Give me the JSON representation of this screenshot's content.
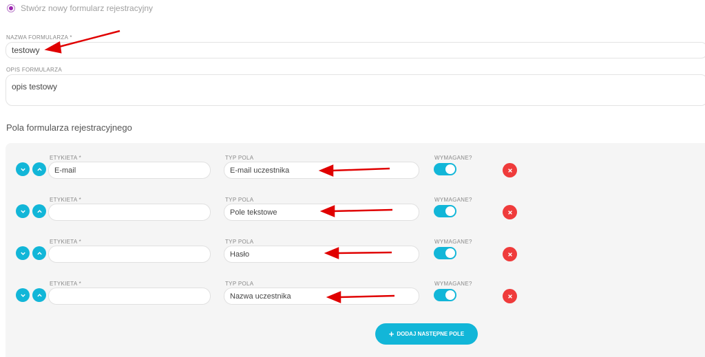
{
  "header": {
    "radio_label": "Stwórz nowy formularz rejestracyjny"
  },
  "form": {
    "name_label": "NAZWA FORMULARZA *",
    "name_value": "testowy",
    "desc_label": "OPIS FORMULARZA",
    "desc_value": "opis testowy"
  },
  "fields_section": {
    "title": "Pola formularza rejestracyjnego",
    "rows": [
      {
        "label_caption": "ETYKIETA *",
        "label_value": "E-mail",
        "type_caption": "TYP POLA",
        "type_value": "E-mail uczestnika",
        "required_caption": "WYMAGANE?",
        "required": true
      },
      {
        "label_caption": "ETYKIETA *",
        "label_value": "",
        "type_caption": "TYP POLA",
        "type_value": "Pole tekstowe",
        "required_caption": "WYMAGANE?",
        "required": true
      },
      {
        "label_caption": "ETYKIETA *",
        "label_value": "",
        "type_caption": "TYP POLA",
        "type_value": "Hasło",
        "required_caption": "WYMAGANE?",
        "required": true
      },
      {
        "label_caption": "ETYKIETA *",
        "label_value": "",
        "type_caption": "TYP POLA",
        "type_value": "Nazwa uczestnika",
        "required_caption": "WYMAGANE?",
        "required": true
      }
    ],
    "add_button_label": "DODAJ NASTĘPNE POLE"
  },
  "colors": {
    "accent": "#12b6d8",
    "danger": "#ef3b3b",
    "radio": "#9c27b0",
    "annotation_arrow": "#e00000"
  },
  "icons": {
    "move_down": "chevron-down-icon",
    "move_up": "chevron-up-icon",
    "delete": "close-icon",
    "add": "plus-icon"
  }
}
